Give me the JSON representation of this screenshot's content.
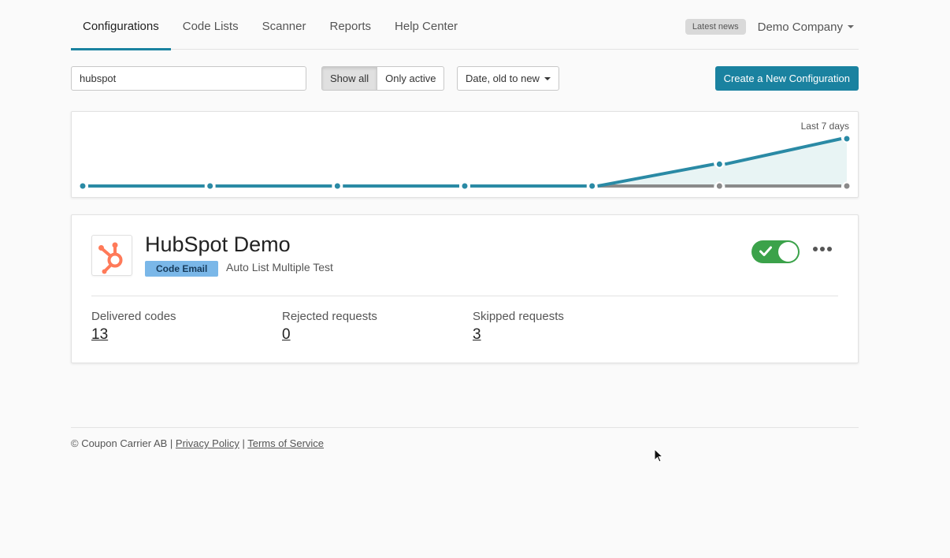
{
  "nav": {
    "tabs": [
      {
        "label": "Configurations",
        "active": true
      },
      {
        "label": "Code Lists"
      },
      {
        "label": "Scanner"
      },
      {
        "label": "Reports"
      },
      {
        "label": "Help Center"
      }
    ],
    "news_badge": "Latest news",
    "company": "Demo Company"
  },
  "toolbar": {
    "search_value": "hubspot",
    "filter_show_all": "Show all",
    "filter_only_active": "Only active",
    "sort_label": "Date, old to new",
    "create_button": "Create a New Configuration"
  },
  "chart_data": {
    "type": "line",
    "title": "Last 7 days",
    "x": [
      1,
      2,
      3,
      4,
      5,
      6,
      7
    ],
    "series": [
      {
        "values": [
          0,
          0,
          0,
          0,
          0,
          6,
          13
        ],
        "color": "#2a8aa5"
      },
      {
        "values": [
          0,
          0,
          0,
          0,
          0,
          0,
          0
        ],
        "color": "#8a8a8a"
      }
    ],
    "ylim": [
      0,
      13
    ],
    "grid": false
  },
  "config": {
    "title": "HubSpot Demo",
    "badge": "Code Email",
    "subtitle": "Auto List Multiple Test",
    "enabled": true,
    "stats": [
      {
        "label": "Delivered codes",
        "value": "13"
      },
      {
        "label": "Rejected requests",
        "value": "0"
      },
      {
        "label": "Skipped requests",
        "value": "3"
      }
    ],
    "logo_icon": "hubspot-logo",
    "brand_color": "#ff7a59",
    "toggle_color": "#3ba24a"
  },
  "footer": {
    "copyright": "© Coupon Carrier AB",
    "privacy": "Privacy Policy",
    "terms": "Terms of Service"
  }
}
